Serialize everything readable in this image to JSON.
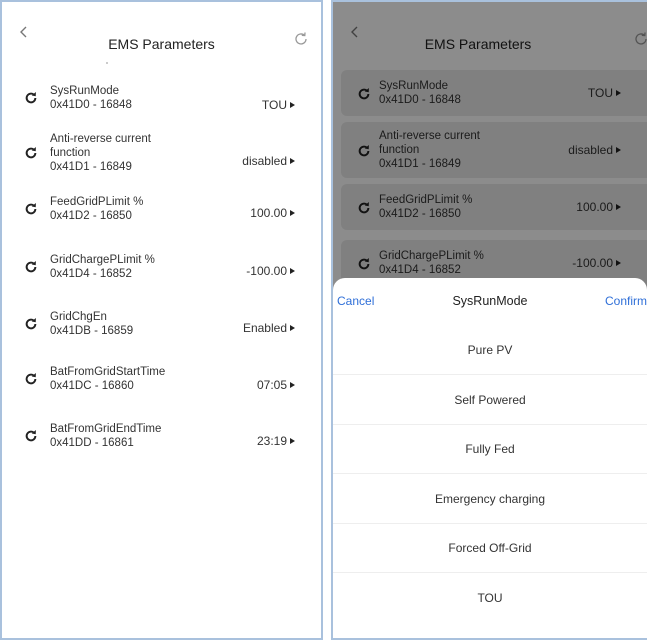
{
  "header": {
    "title": "EMS Parameters"
  },
  "params": [
    {
      "name": "SysRunMode",
      "addr": "0x41D0 - 16848",
      "value": "TOU"
    },
    {
      "name": "Anti-reverse current\nfunction",
      "addr": "0x41D1 - 16849",
      "value": "disabled"
    },
    {
      "name": "FeedGridPLimit %",
      "addr": "0x41D2 - 16850",
      "value": "100.00"
    },
    {
      "name": "GridChargePLimit %",
      "addr": "0x41D4 - 16852",
      "value": "-100.00"
    },
    {
      "name": "GridChgEn",
      "addr": "0x41DB - 16859",
      "value": "Enabled"
    },
    {
      "name": "BatFromGridStartTime",
      "addr": "0x41DC - 16860",
      "value": "07:05"
    },
    {
      "name": "BatFromGridEndTime",
      "addr": "0x41DD - 16861",
      "value": "23:19"
    }
  ],
  "picker": {
    "cancel": "Cancel",
    "title": "SysRunMode",
    "confirm": "Confirm",
    "options": [
      "Pure PV",
      "Self Powered",
      "Fully Fed",
      "Emergency charging",
      "Forced Off-Grid",
      "TOU"
    ]
  },
  "colors": {
    "accent": "#2f6fd8",
    "border": "#a9c1dd",
    "card": "#eaeaea"
  }
}
